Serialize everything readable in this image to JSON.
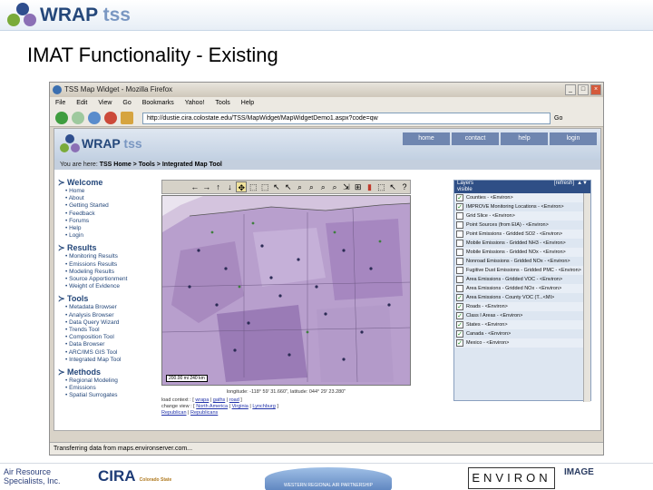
{
  "slide": {
    "brand_main": "WRAP",
    "brand_sub": "tss",
    "title": "IMAT Functionality - Existing"
  },
  "browser": {
    "window_title": "TSS Map Widget - Mozilla Firefox",
    "menu": [
      "File",
      "Edit",
      "View",
      "Go",
      "Bookmarks",
      "Yahoo!",
      "Tools",
      "Help"
    ],
    "url": "http://dustie.cira.colostate.edu/TSS/MapWidget/MapWidgetDemo1.aspx?code=qw",
    "go_label": "Go",
    "status": "Transferring data from maps.environserver.com..."
  },
  "site": {
    "brand_main": "WRAP",
    "brand_sub": "tss",
    "nav": [
      "home",
      "contact",
      "help",
      "login"
    ],
    "breadcrumb_prefix": "You are here:",
    "breadcrumb": "TSS Home > Tools > Integrated Map Tool",
    "sections": [
      {
        "title": "Welcome",
        "items": [
          "Home",
          "About",
          "Getting Started",
          "Feedback",
          "Forums",
          "Help",
          "Login"
        ]
      },
      {
        "title": "Results",
        "items": [
          "Monitoring Results",
          "Emissions Results",
          "Modeling Results",
          "Source Apportionment",
          "Weight of Evidence"
        ]
      },
      {
        "title": "Tools",
        "items": [
          "Metadata Browser",
          "Analysis Browser",
          "Data Query Wizard",
          "Trends Tool",
          "Composition Tool",
          "Data Browser",
          "ARC/IMS GIS Tool",
          "Integrated Map Tool"
        ]
      },
      {
        "title": "Methods",
        "items": [
          "Regional Modeling",
          "Emissions",
          "Spatial Surrogates"
        ]
      }
    ]
  },
  "map": {
    "scale": "200.00 mi",
    "scale_km": "240 km",
    "coords": "longitude: -118° 59' 31.660\", latitude: 044° 29' 23.280\"",
    "load_context_label": "load context :",
    "load_context_links": [
      "wrapa",
      "gaths",
      "road"
    ],
    "change_view_label": "change view :",
    "change_view_links": [
      "North America",
      "Virginia",
      "Lynchburg"
    ],
    "extra_links": [
      "Republican",
      "Republicans"
    ]
  },
  "layers": {
    "title": "Layers",
    "subtitle": "visible",
    "refresh": "[refresh]",
    "rows": [
      {
        "label": "Counties - <Environ>",
        "checked": true
      },
      {
        "label": "IMPROVE Monitoring Locations - <Environ>",
        "checked": true
      },
      {
        "label": "Grid Slice - <Environ>",
        "checked": false
      },
      {
        "label": "Point Sources (from EIA) - <Environ>",
        "checked": false
      },
      {
        "label": "Point Emissions - Gridded SO2 - <Environ>",
        "checked": false
      },
      {
        "label": "Mobile Emissions - Gridded NH3 - <Environ>",
        "checked": false
      },
      {
        "label": "Mobile Emissions - Gridded NOx - <Environ>",
        "checked": false
      },
      {
        "label": "Nonroad Emissions - Gridded NOx - <Environ>",
        "checked": false
      },
      {
        "label": "Fugitive Dust Emissions - Gridded PMC - <Environ>",
        "checked": false
      },
      {
        "label": "Area Emissions - Gridded VOC - <Environ>",
        "checked": false
      },
      {
        "label": "Area Emissions - Gridded NOx - <Environ>",
        "checked": false
      },
      {
        "label": "Area Emissions - County VOC (T...<MI>",
        "checked": true
      },
      {
        "label": "Roads - <Environ>",
        "checked": true
      },
      {
        "label": "Class I Areas - <Environ>",
        "checked": true
      },
      {
        "label": "States - <Environ>",
        "checked": true
      },
      {
        "label": "Canada - <Environ>",
        "checked": true
      },
      {
        "label": "Mexico - <Environ>",
        "checked": true
      }
    ]
  },
  "footer": {
    "rsi": "Air Resource Specialists, Inc.",
    "cira": "CIRA",
    "cira_sub": "Colorado State",
    "wrap": "WESTERN REGIONAL AIR PARTNERSHIP",
    "environ": "ENVIRON",
    "image": "IMAGE"
  },
  "colors": {
    "brand": "#24477a",
    "accent": "#7a97c2",
    "map_fill": "#b9a0cc"
  }
}
